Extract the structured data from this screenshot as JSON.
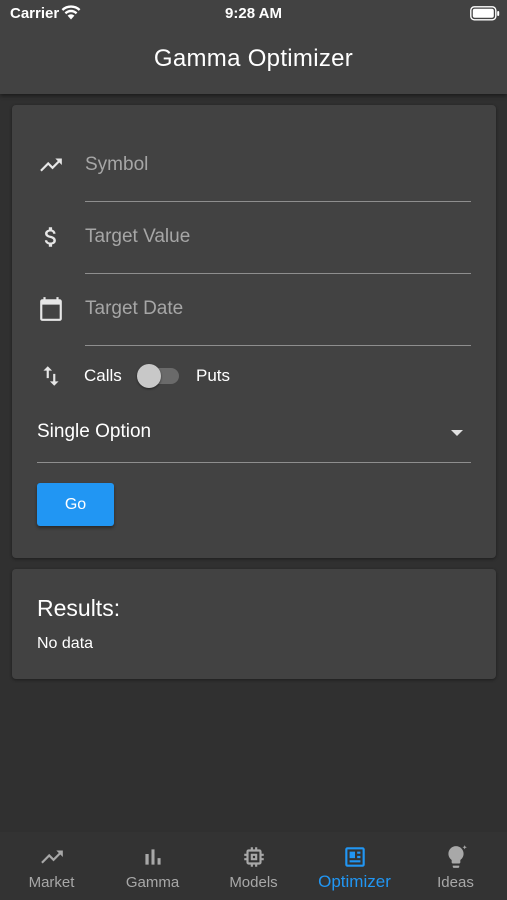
{
  "status_bar": {
    "carrier": "Carrier",
    "time": "9:28 AM"
  },
  "app_bar": {
    "title": "Gamma Optimizer"
  },
  "form": {
    "symbol_placeholder": "Symbol",
    "symbol_value": "",
    "target_value_placeholder": "Target Value",
    "target_value_value": "",
    "target_date_placeholder": "Target Date",
    "target_date_value": "",
    "toggle": {
      "left_label": "Calls",
      "right_label": "Puts",
      "on": false
    },
    "strategy_select": {
      "selected": "Single Option"
    },
    "go_label": "Go",
    "icons": [
      "trending-up-icon",
      "dollar-icon",
      "calendar-icon",
      "swap-vertical-icon",
      "dropdown-arrow-icon"
    ]
  },
  "results": {
    "title": "Results:",
    "body": "No data"
  },
  "bottom_nav": {
    "items": [
      {
        "label": "Market",
        "icon": "trending-up-icon",
        "active": false
      },
      {
        "label": "Gamma",
        "icon": "bar-chart-icon",
        "active": false
      },
      {
        "label": "Models",
        "icon": "chip-icon",
        "active": false
      },
      {
        "label": "Optimizer",
        "icon": "dashboard-icon",
        "active": true
      },
      {
        "label": "Ideas",
        "icon": "lightbulb-icon",
        "active": false
      }
    ]
  },
  "colors": {
    "background": "#303030",
    "surface": "#424242",
    "accent": "#2196f3",
    "inactive_text": "#a8a8a8"
  }
}
